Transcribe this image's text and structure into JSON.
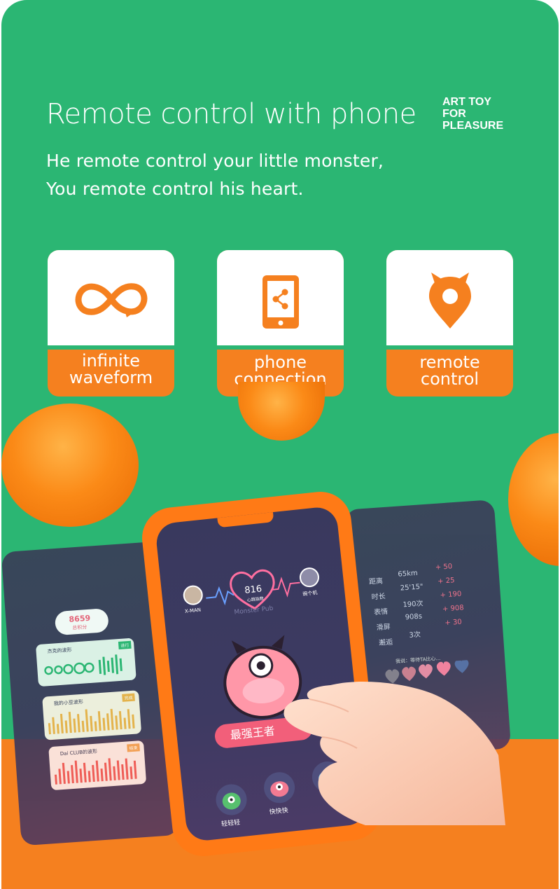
{
  "header": {
    "title": "Remote control with phone",
    "brand_line1": "ART TOY",
    "brand_line2": "FOR",
    "brand_line3": "PLEASURE",
    "subtitle_line1": "He remote control your little monster,",
    "subtitle_line2": "You remote control his heart."
  },
  "features": [
    {
      "icon": "infinity-icon",
      "line1": "infinite",
      "line2": "waveform"
    },
    {
      "icon": "phone-share-icon",
      "line1": "phone",
      "line2": "connection"
    },
    {
      "icon": "monster-pin-icon",
      "line1": "remote",
      "line2": "control"
    }
  ],
  "main_phone": {
    "heart_value": "816",
    "heart_caption": "心跳指数",
    "left_user": "X-MAN",
    "right_user": "豌个机",
    "app_name": "Monster Pub",
    "action_label": "最强王者",
    "modes": [
      "轻轻轻",
      "快快快"
    ]
  },
  "left_phone": {
    "score": "8659",
    "score_caption": "总积分",
    "cards": [
      {
        "title": "杰克的波形",
        "tag": "进行"
      },
      {
        "title": "我的小豆波形",
        "tag": "完成"
      },
      {
        "title": "Dai CLUB的波形",
        "tag": "结束"
      }
    ]
  },
  "right_phone": {
    "stats": [
      {
        "label": "距离",
        "value": "65km",
        "delta": "+ 50"
      },
      {
        "label": "时长",
        "value": "25'15\"",
        "delta": "+ 25"
      },
      {
        "label": "表情",
        "value": "190次",
        "delta": "+ 190"
      },
      {
        "label": "滑屏",
        "value": "908s",
        "delta": "+ 908"
      },
      {
        "label": "邂逅",
        "value": "3次",
        "delta": "+ 30"
      }
    ],
    "waiting_text": "我说：等待TA比心..."
  },
  "colors": {
    "background": "#2bb673",
    "accent": "#f5801f",
    "card_top": "#ffffff"
  }
}
